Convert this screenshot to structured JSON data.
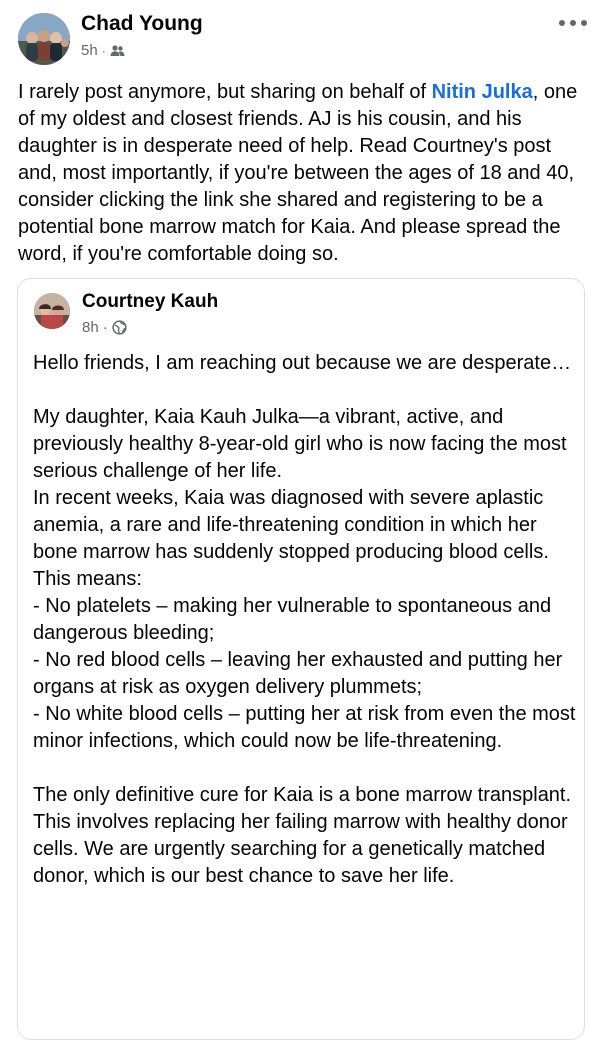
{
  "post": {
    "author": "Chad Young",
    "time": "5h",
    "audience_icon": "friends-icon",
    "body": {
      "before_mention": "I rarely post anymore, but sharing on behalf of ",
      "mention": "Nitin Julka",
      "after_mention": ", one of my oldest and closest friends. AJ is his cousin, and his daughter is in desperate need of help. Read Courtney's post and, most importantly,  if you're between the ages of 18 and 40, consider clicking the link she shared and registering to be a potential bone marrow match for Kaia. And please spread the word, if you're comfortable doing so."
    }
  },
  "shared_post": {
    "author": "Courtney Kauh",
    "time": "8h",
    "audience_icon": "globe-icon",
    "paragraphs": [
      "Hello friends, I am reaching out because we are desperate…",
      "",
      "My daughter, Kaia Kauh Julka—a vibrant, active, and previously healthy 8-year-old girl who is now facing the most serious challenge of her life.",
      "In recent weeks, Kaia was diagnosed with severe aplastic anemia, a rare and life-threatening condition in which her bone marrow has suddenly stopped producing blood cells.",
      "This means:",
      "- No platelets – making her vulnerable to spontaneous and dangerous bleeding;",
      "- No red blood cells – leaving her exhausted and putting her organs at risk as oxygen delivery plummets;",
      "- No white blood cells – putting her at risk from even the most minor infections, which could now be life-threatening.",
      "",
      "The only definitive cure for Kaia is a bone marrow transplant. This involves replacing her failing marrow with healthy donor cells. We are urgently searching for a genetically matched donor, which is our best chance to save her life."
    ]
  }
}
